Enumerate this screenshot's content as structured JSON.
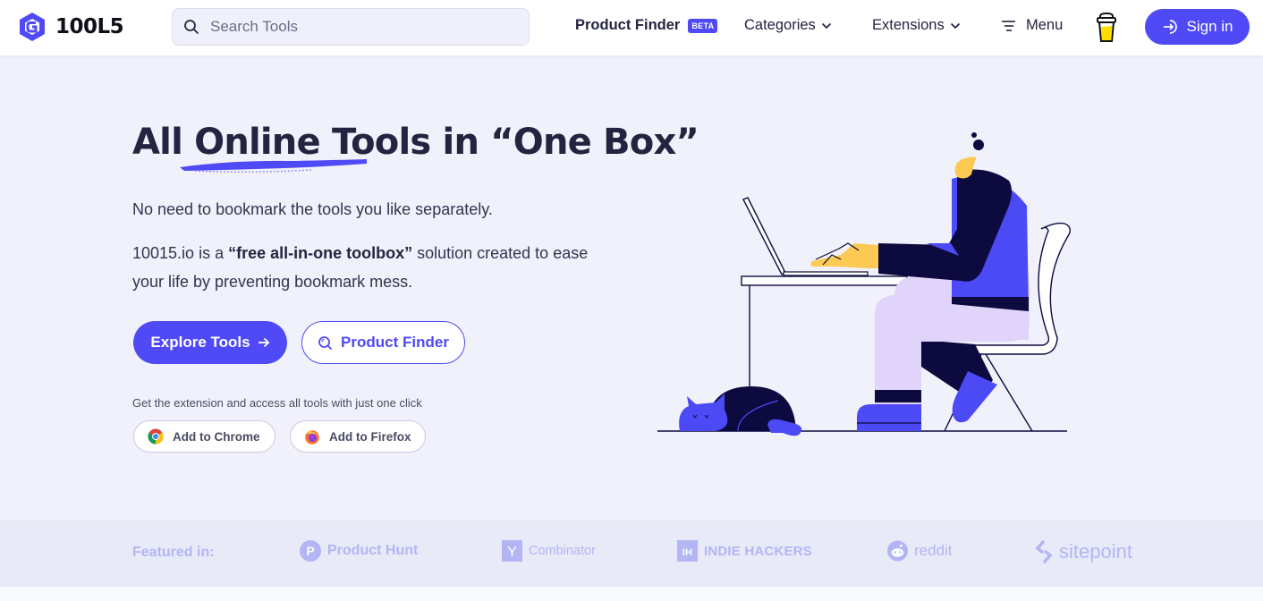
{
  "header": {
    "logo_text": "100L5",
    "search_placeholder": "Search Tools",
    "nav": {
      "product_finder": "Product Finder",
      "beta_badge": "BETA",
      "categories": "Categories",
      "extensions": "Extensions",
      "menu": "Menu"
    },
    "signin_label": "Sign in"
  },
  "hero": {
    "title_prefix": "All ",
    "title_highlight": "Online Tools",
    "title_suffix": " in “One Box”",
    "paragraph1": "No need to bookmark the tools you like separately.",
    "paragraph2_pre": "10015.io is a ",
    "paragraph2_bold": "“free all-in-one toolbox”",
    "paragraph2_post": " solution created to ease your life by preventing bookmark mess.",
    "explore_button": "Explore Tools",
    "finder_button": "Product Finder",
    "extension_note": "Get the extension and access all tools with just one click",
    "chrome_button": "Add to Chrome",
    "firefox_button": "Add to Firefox"
  },
  "featured": {
    "label": "Featured in:",
    "logos": [
      {
        "name": "Product Hunt",
        "icon": "P"
      },
      {
        "name": "Combinator",
        "icon": "Y"
      },
      {
        "name": "INDIE HACKERS",
        "icon": "IH"
      },
      {
        "name": "reddit",
        "icon": "reddit-alien"
      },
      {
        "name": "sitepoint",
        "icon": "sitepoint-chevrons"
      }
    ]
  },
  "colors": {
    "accent": "#4f4af5",
    "text_dark": "#23243f",
    "background": "#f1f1fb",
    "featured_bg": "#e8eaf8",
    "featured_text": "#b3b5f5"
  }
}
